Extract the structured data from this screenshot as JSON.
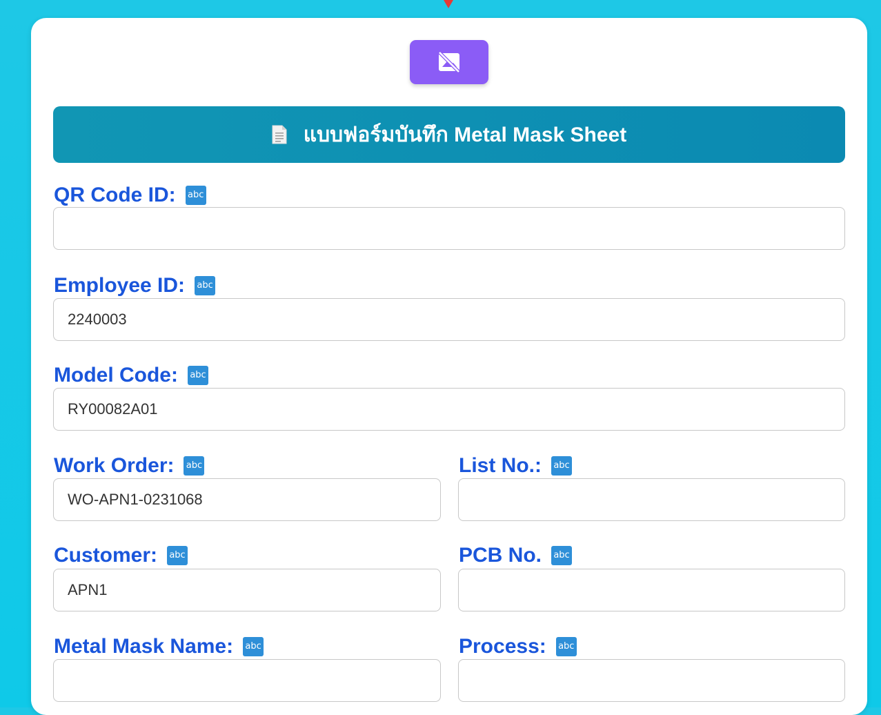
{
  "header": {
    "title": "แบบฟอร์มบันทึก Metal Mask Sheet",
    "title_icon": "document-icon"
  },
  "camera_button": {
    "icon": "video-off-icon"
  },
  "type_badge": "abc",
  "fields": {
    "qr_code_id": {
      "label": "QR Code ID:",
      "value": ""
    },
    "employee_id": {
      "label": "Employee ID:",
      "value": "2240003"
    },
    "model_code": {
      "label": "Model Code:",
      "value": "RY00082A01"
    },
    "work_order": {
      "label": "Work Order:",
      "value": "WO-APN1-0231068"
    },
    "list_no": {
      "label": "List No.:",
      "value": ""
    },
    "customer": {
      "label": "Customer:",
      "value": "APN1"
    },
    "pcb_no": {
      "label": "PCB No.",
      "value": ""
    },
    "metal_mask_name": {
      "label": "Metal Mask Name:",
      "value": ""
    },
    "process": {
      "label": "Process:",
      "value": ""
    }
  },
  "colors": {
    "background": "#1ec8e6",
    "header": "#0b8ab2",
    "label": "#1a56db",
    "camera_button": "#8b5cf6",
    "badge": "#2e8fd8"
  }
}
